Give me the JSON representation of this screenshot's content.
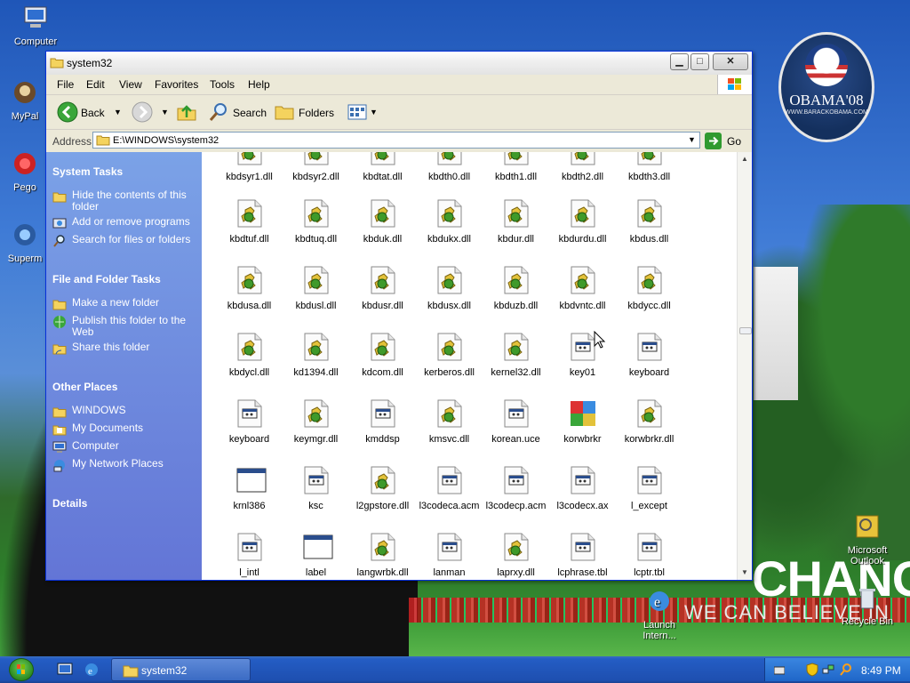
{
  "window": {
    "title": "system32"
  },
  "menu": [
    "File",
    "Edit",
    "View",
    "Favorites",
    "Tools",
    "Help"
  ],
  "toolbar": {
    "back": "Back",
    "search": "Search",
    "folders": "Folders"
  },
  "address": {
    "label": "Address",
    "value": "E:\\WINDOWS\\system32",
    "go": "Go"
  },
  "taskpane": {
    "system_tasks": {
      "title": "System Tasks",
      "items": [
        "Hide the contents of this folder",
        "Add or remove programs",
        "Search for files or folders"
      ]
    },
    "file_folder_tasks": {
      "title": "File and Folder Tasks",
      "items": [
        "Make a new folder",
        "Publish this folder to the Web",
        "Share this folder"
      ]
    },
    "other_places": {
      "title": "Other Places",
      "items": [
        "WINDOWS",
        "My Documents",
        "Computer",
        "My Network Places"
      ]
    },
    "details": {
      "title": "Details"
    }
  },
  "files": [
    [
      "kbdsyr1.dll",
      "kbdsyr2.dll",
      "kbdtat.dll",
      "kbdth0.dll",
      "kbdth1.dll",
      "kbdth2.dll",
      "kbdth3.dll"
    ],
    [
      "kbdtuf.dll",
      "kbdtuq.dll",
      "kbduk.dll",
      "kbdukx.dll",
      "kbdur.dll",
      "kbdurdu.dll",
      "kbdus.dll"
    ],
    [
      "kbdusa.dll",
      "kbdusl.dll",
      "kbdusr.dll",
      "kbdusx.dll",
      "kbduzb.dll",
      "kbdvntc.dll",
      "kbdycc.dll"
    ],
    [
      "kbdycl.dll",
      "kd1394.dll",
      "kdcom.dll",
      "kerberos.dll",
      "kernel32.dll",
      "key01",
      "keyboard"
    ],
    [
      "keyboard",
      "keymgr.dll",
      "kmddsp",
      "kmsvc.dll",
      "korean.uce",
      "korwbrkr",
      "korwbrkr.dll"
    ],
    [
      "krnl386",
      "ksc",
      "l2gpstore.dll",
      "l3codeca.acm",
      "l3codecp.acm",
      "l3codecx.ax",
      "l_except"
    ],
    [
      "l_intl",
      "label",
      "langwrbk.dll",
      "lanman",
      "laprxy.dll",
      "lcphrase.tbl",
      "lcptr.tbl"
    ]
  ],
  "file_types": [
    [
      "dll",
      "dll",
      "dll",
      "dll",
      "dll",
      "dll",
      "dll"
    ],
    [
      "dll",
      "dll",
      "dll",
      "dll",
      "dll",
      "dll",
      "dll"
    ],
    [
      "dll",
      "dll",
      "dll",
      "dll",
      "dll",
      "dll",
      "dll"
    ],
    [
      "dll",
      "dll",
      "dll",
      "dll",
      "dll",
      "generic",
      "generic"
    ],
    [
      "generic",
      "dll",
      "generic",
      "dll",
      "generic",
      "puzzle",
      "dll"
    ],
    [
      "window",
      "generic",
      "dll",
      "generic",
      "generic",
      "generic",
      "generic"
    ],
    [
      "generic",
      "window",
      "dll",
      "generic",
      "dll",
      "generic",
      "generic"
    ]
  ],
  "desktop": {
    "icons": [
      "Computer",
      "MyPal",
      "Pego",
      "Superm",
      "Microsoft Outlook",
      "Launch Intern...",
      "Recycle Bin"
    ],
    "badge_name": "OBAMA'08",
    "badge_sub": "WWW.BARACKOBAMA.COM",
    "poster_big": "CHANGE",
    "poster_small": "WE CAN BELIEVE IN"
  },
  "taskbar": {
    "task": "system32",
    "clock": "8:49 PM"
  },
  "colors": {
    "titlebar": "#f0f0f0",
    "taskpane": "#6f8fe0",
    "taskbar": "#245dc4",
    "dll_icon_green": "#3f9a2a",
    "dll_icon_yellow": "#e3c23a"
  }
}
